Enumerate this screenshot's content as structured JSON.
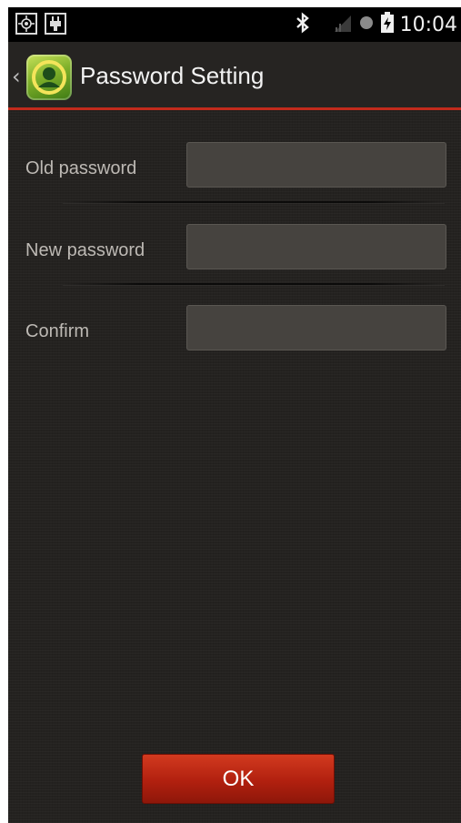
{
  "status_bar": {
    "time": "10:04",
    "icons": [
      "gps-target-icon",
      "usb-debug-icon",
      "bluetooth-icon",
      "signal-icon",
      "record-dot-icon",
      "battery-charging-icon"
    ]
  },
  "action_bar": {
    "title": "Password Setting",
    "back_icon": "chevron-left-icon",
    "app_icon": "app-logo-icon"
  },
  "form": {
    "old_password": {
      "label": "Old password",
      "value": "",
      "placeholder": ""
    },
    "new_password": {
      "label": "New password",
      "value": "",
      "placeholder": ""
    },
    "confirm": {
      "label": "Confirm",
      "value": "",
      "placeholder": ""
    }
  },
  "ok_button": {
    "label": "OK"
  },
  "colors": {
    "accent": "#c22b1c",
    "background": "#242220",
    "field": "#46433f"
  }
}
